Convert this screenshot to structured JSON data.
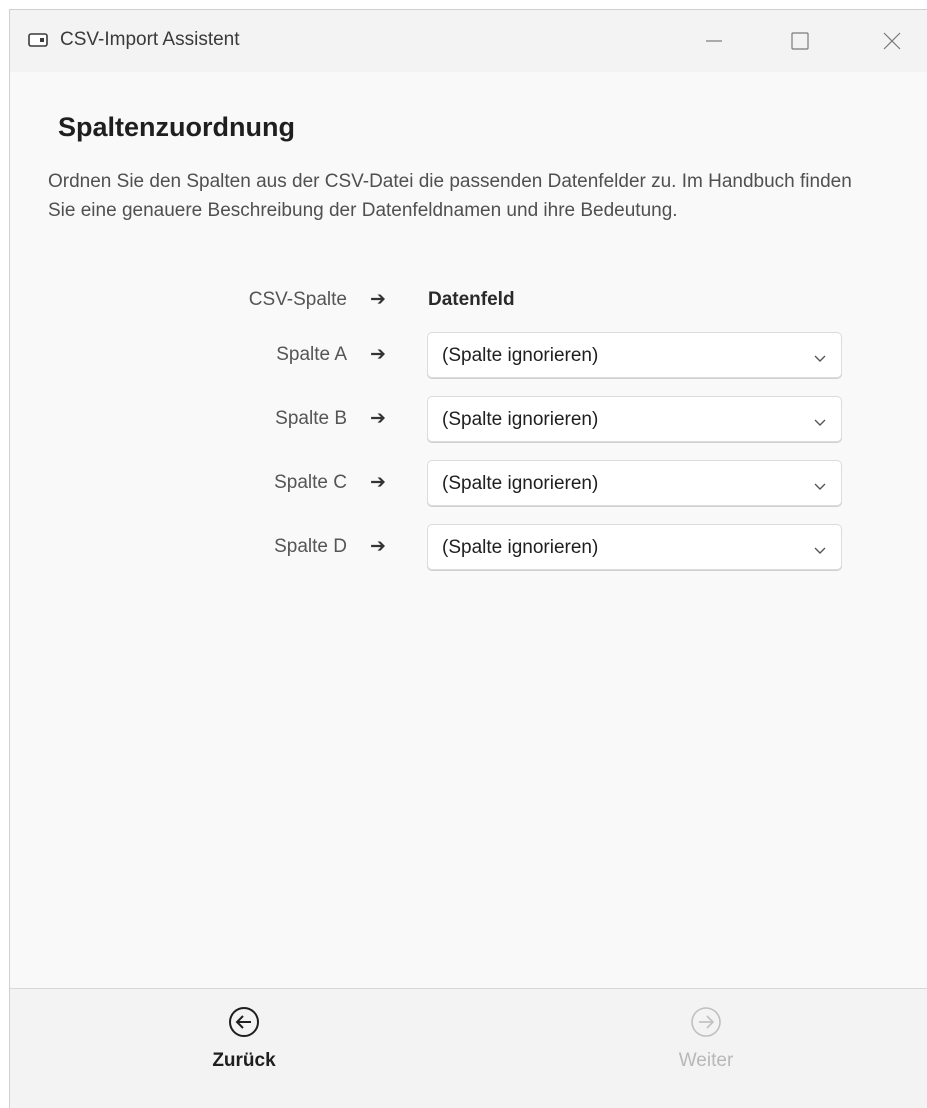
{
  "window": {
    "title": "CSV-Import Assistent",
    "icons": {
      "app": "window-icon",
      "minimize": "minimize-icon",
      "maximize": "maximize-icon",
      "close": "close-icon"
    }
  },
  "main": {
    "heading": "Spaltenzuordnung",
    "description": "Ordnen Sie den Spalten aus der CSV-Datei die passenden Datenfelder zu. Im Handbuch finden Sie eine genauere Beschreibung der Datenfeldnamen und ihre Bedeutung.",
    "mapping_header": {
      "csv_column": "CSV-Spalte",
      "arrow": "➔",
      "data_field": "Datenfeld"
    },
    "rows": [
      {
        "column": "Spalte A",
        "arrow": "➔",
        "value": "(Spalte ignorieren)"
      },
      {
        "column": "Spalte B",
        "arrow": "➔",
        "value": "(Spalte ignorieren)"
      },
      {
        "column": "Spalte C",
        "arrow": "➔",
        "value": "(Spalte ignorieren)"
      },
      {
        "column": "Spalte D",
        "arrow": "➔",
        "value": "(Spalte ignorieren)"
      }
    ]
  },
  "footer": {
    "back_label": "Zurück",
    "next_label": "Weiter",
    "back_icon": "arrow-left-circle-icon",
    "next_icon": "arrow-right-circle-icon",
    "next_enabled": false
  },
  "colors": {
    "title_bar": "#f3f3f3",
    "content_bg": "#f9f9f9",
    "disabled_text": "#b8b8b8"
  }
}
